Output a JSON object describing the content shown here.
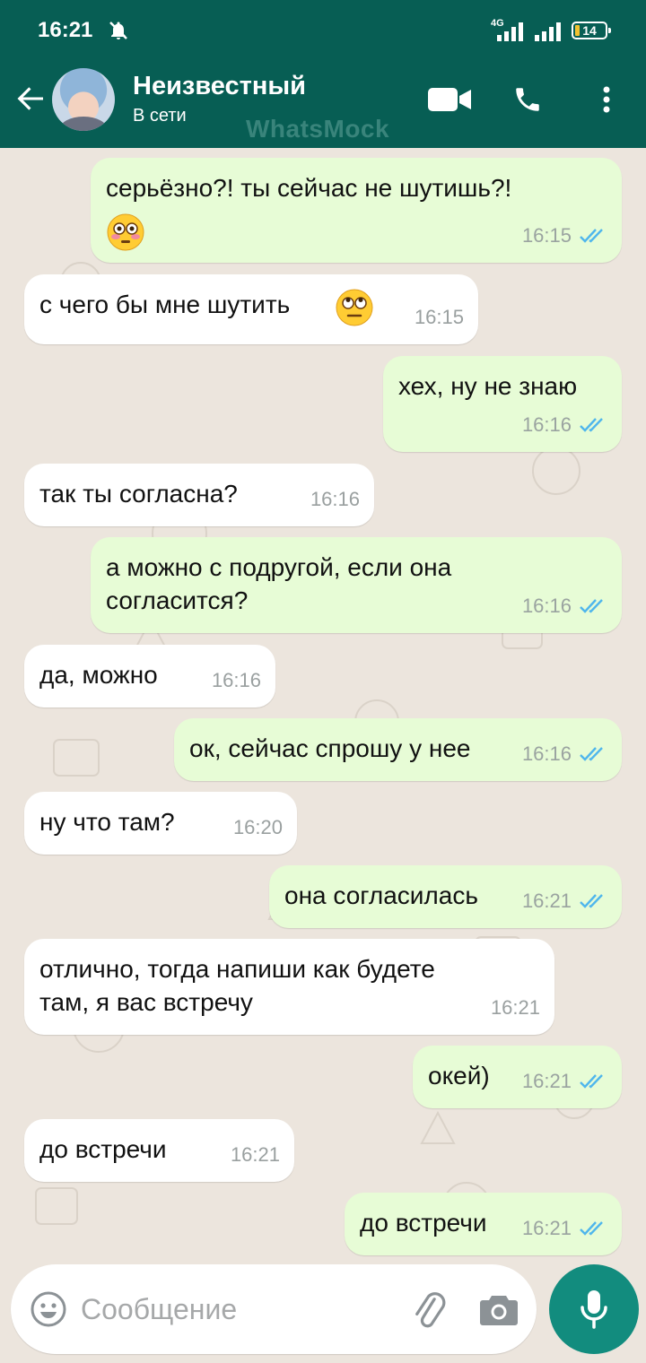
{
  "status_bar": {
    "time": "16:21",
    "network": "4G",
    "battery": "14"
  },
  "header": {
    "contact_name": "Неизвестный",
    "contact_status": "В сети",
    "watermark": "WhatsMock"
  },
  "messages": [
    {
      "dir": "out",
      "text": "серьёзно?! ты сейчас не шутишь?!",
      "emoji": "flushed-face",
      "time": "16:15",
      "read": true
    },
    {
      "dir": "in",
      "text": "с чего бы мне шутить",
      "emoji": "eye-roll-face",
      "time": "16:15"
    },
    {
      "dir": "out",
      "text": "хех, ну не знаю",
      "time": "16:16",
      "read": true
    },
    {
      "dir": "in",
      "text": "так ты согласна?",
      "time": "16:16"
    },
    {
      "dir": "out",
      "text": "а можно с подругой, если она\nсогласится?",
      "time": "16:16",
      "read": true
    },
    {
      "dir": "in",
      "text": "да, можно",
      "time": "16:16"
    },
    {
      "dir": "out",
      "text": "ок, сейчас спрошу у нее",
      "time": "16:16",
      "read": true
    },
    {
      "dir": "in",
      "text": "ну что там?",
      "time": "16:20"
    },
    {
      "dir": "out",
      "text": "она согласилась",
      "time": "16:21",
      "read": true
    },
    {
      "dir": "in",
      "text": "отлично, тогда напиши как будете\nтам, я вас встречу",
      "time": "16:21"
    },
    {
      "dir": "out",
      "text": "окей)",
      "time": "16:21",
      "read": true
    },
    {
      "dir": "in",
      "text": "до встречи",
      "time": "16:21"
    },
    {
      "dir": "out",
      "text": "до встречи",
      "time": "16:21",
      "read": true
    }
  ],
  "input": {
    "placeholder": "Сообщение"
  },
  "colors": {
    "header": "#075e54",
    "outgoing_bubble": "#e7fcd6",
    "incoming_bubble": "#ffffff",
    "chat_background": "#ece5dd",
    "read_ticks": "#4fb6ec",
    "mic_button": "#128c7e"
  }
}
